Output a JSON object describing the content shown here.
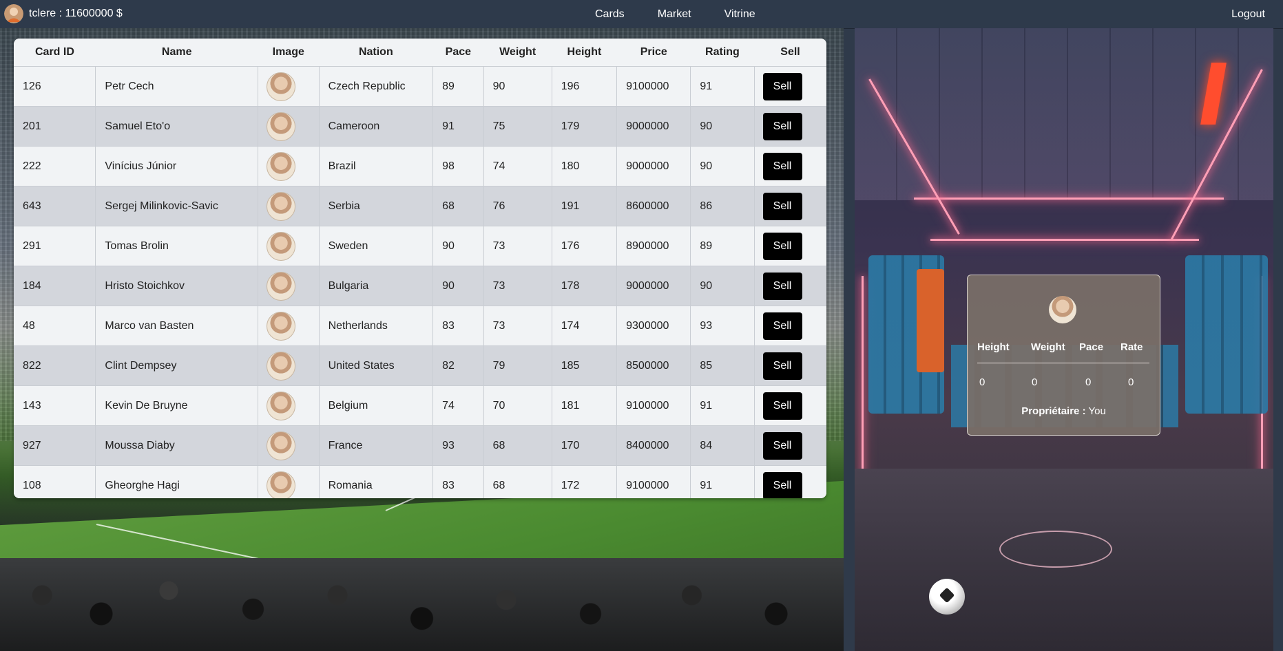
{
  "nav": {
    "user_text": "tclere : 11600000 $",
    "links": [
      "Cards",
      "Market",
      "Vitrine"
    ],
    "logout": "Logout"
  },
  "table": {
    "headers": [
      "Card ID",
      "Name",
      "Image",
      "Nation",
      "Pace",
      "Weight",
      "Height",
      "Price",
      "Rating",
      "Sell"
    ],
    "rows": [
      {
        "id": "126",
        "name": "Petr Cech",
        "nation": "Czech Republic",
        "pace": "89",
        "weight": "90",
        "height": "196",
        "price": "9100000",
        "rating": "91",
        "sell": "Sell"
      },
      {
        "id": "201",
        "name": "Samuel Eto'o",
        "nation": "Cameroon",
        "pace": "91",
        "weight": "75",
        "height": "179",
        "price": "9000000",
        "rating": "90",
        "sell": "Sell"
      },
      {
        "id": "222",
        "name": "Vinícius Júnior",
        "nation": "Brazil",
        "pace": "98",
        "weight": "74",
        "height": "180",
        "price": "9000000",
        "rating": "90",
        "sell": "Sell"
      },
      {
        "id": "643",
        "name": "Sergej Milinkovic-Savic",
        "nation": "Serbia",
        "pace": "68",
        "weight": "76",
        "height": "191",
        "price": "8600000",
        "rating": "86",
        "sell": "Sell"
      },
      {
        "id": "291",
        "name": "Tomas Brolin",
        "nation": "Sweden",
        "pace": "90",
        "weight": "73",
        "height": "176",
        "price": "8900000",
        "rating": "89",
        "sell": "Sell"
      },
      {
        "id": "184",
        "name": "Hristo Stoichkov",
        "nation": "Bulgaria",
        "pace": "90",
        "weight": "73",
        "height": "178",
        "price": "9000000",
        "rating": "90",
        "sell": "Sell"
      },
      {
        "id": "48",
        "name": "Marco van Basten",
        "nation": "Netherlands",
        "pace": "83",
        "weight": "73",
        "height": "174",
        "price": "9300000",
        "rating": "93",
        "sell": "Sell"
      },
      {
        "id": "822",
        "name": "Clint Dempsey",
        "nation": "United States",
        "pace": "82",
        "weight": "79",
        "height": "185",
        "price": "8500000",
        "rating": "85",
        "sell": "Sell"
      },
      {
        "id": "143",
        "name": "Kevin De Bruyne",
        "nation": "Belgium",
        "pace": "74",
        "weight": "70",
        "height": "181",
        "price": "9100000",
        "rating": "91",
        "sell": "Sell"
      },
      {
        "id": "927",
        "name": "Moussa Diaby",
        "nation": "France",
        "pace": "93",
        "weight": "68",
        "height": "170",
        "price": "8400000",
        "rating": "84",
        "sell": "Sell"
      },
      {
        "id": "108",
        "name": "Gheorghe Hagi",
        "nation": "Romania",
        "pace": "83",
        "weight": "68",
        "height": "172",
        "price": "9100000",
        "rating": "91",
        "sell": "Sell"
      }
    ]
  },
  "preview": {
    "headers": [
      "Height",
      "Weight",
      "Pace",
      "Rate"
    ],
    "values": [
      "0",
      "0",
      "0",
      "0"
    ],
    "owner_label": "Propriétaire :",
    "owner_value": "You"
  },
  "colors": {
    "navbar": "#2e3a4b",
    "sell_button": "#000000",
    "preview_card": "#7a6f68"
  },
  "icons": {
    "user_avatar": "avatar-icon",
    "player_photo": "player-avatar-icon"
  }
}
